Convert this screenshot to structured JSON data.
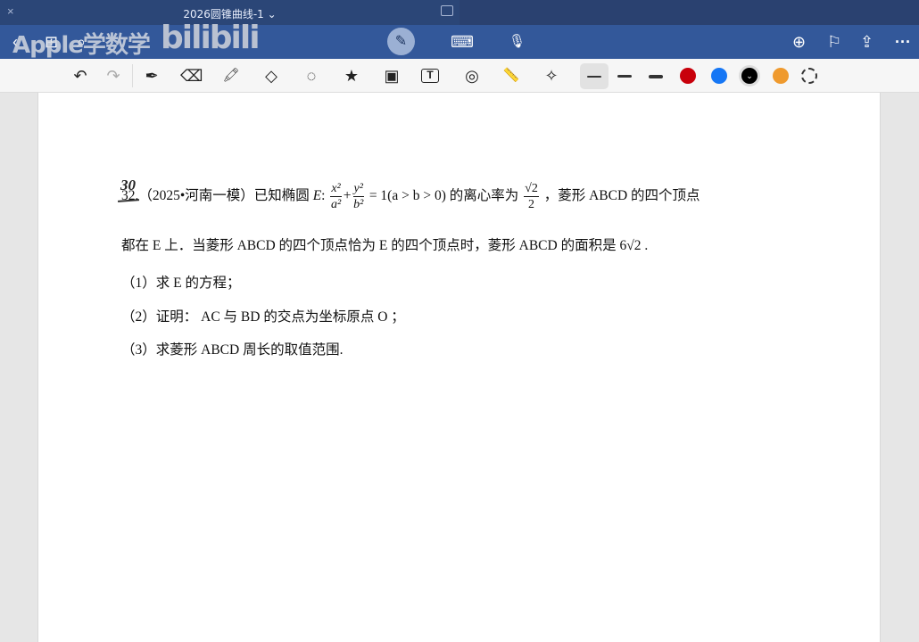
{
  "window": {
    "title": "2026圆锥曲线-1 ⌄",
    "close": "×"
  },
  "watermark": {
    "text": "Apple学数学",
    "brand": "bilibili"
  },
  "nav": {
    "back": "‹",
    "grid": "⊞",
    "search": "⌕",
    "pen": "✎",
    "keyboard": "⌨",
    "mic": "🎙",
    "add_page": "⊕",
    "bookmark": "⚐",
    "share": "⇪",
    "more": "···"
  },
  "toolbar": {
    "undo": "↶",
    "redo": "↷",
    "pen": "✒",
    "eraser": "⌫",
    "highlighter": "🖍",
    "shapes": "◇",
    "lasso": "◌",
    "sticker": "★",
    "image": "▣",
    "text": "T",
    "camera": "◎",
    "ruler": "📏",
    "laser": "✧"
  },
  "colors": {
    "red": "#c8000b",
    "blue": "#1677f5",
    "black": "#000000",
    "orange": "#ef9a2e"
  },
  "doc": {
    "handwritten_number": "30",
    "line1_prefix": "32.（2025•河南一模）已知椭圆",
    "E": "E",
    "colon": ":",
    "x2": "x²",
    "a2": "a²",
    "y2": "y²",
    "b2": "b²",
    "eq": "= 1(a > b > 0)",
    "ecc_text": "的离心率为",
    "sqrt2": "√2",
    "two": "2",
    "line1_suffix": "，菱形 ABCD 的四个顶点",
    "line2": "都在 E 上．当菱形 ABCD 的四个顶点恰为 E 的四个顶点时，菱形 ABCD 的面积是 6√2 .",
    "part1": "（1）求 E 的方程；",
    "part2": "（2）证明： AC 与 BD 的交点为坐标原点 O ；",
    "part3": "（3）求菱形 ABCD 周长的取值范围."
  }
}
